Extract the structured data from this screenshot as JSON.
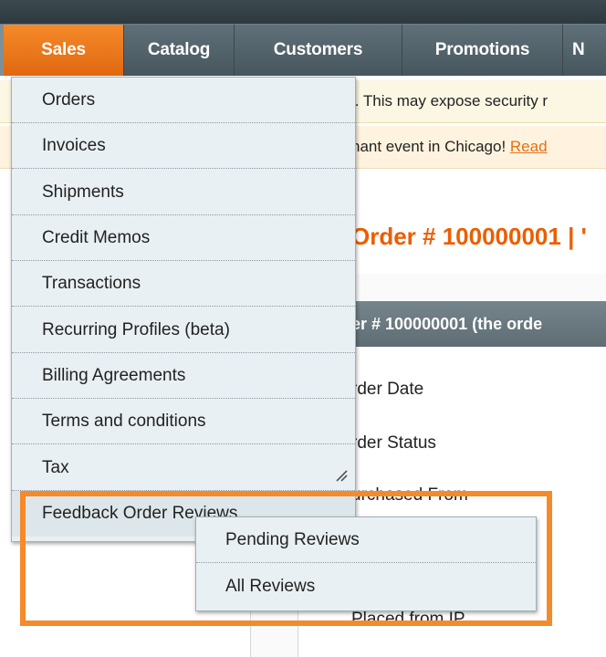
{
  "nav": {
    "tabs": [
      {
        "label": "Sales",
        "active": true
      },
      {
        "label": "Catalog"
      },
      {
        "label": "Customers"
      },
      {
        "label": "Promotions"
      },
      {
        "label": "N"
      }
    ]
  },
  "notices": {
    "security": "l. This may expose security r",
    "event_prefix": "hant event in Chicago! ",
    "event_link": "Read"
  },
  "page": {
    "title": "Order # 100000001 | '",
    "section_title": "er # 100000001 (the orde",
    "rows": [
      "rder Date",
      "rder Status",
      "urchased From",
      "Placed from IP"
    ]
  },
  "sales_menu": {
    "items": [
      "Orders",
      "Invoices",
      "Shipments",
      "Credit Memos",
      "Transactions",
      "Recurring Profiles (beta)",
      "Billing Agreements",
      "Terms and conditions",
      "Tax",
      "Feedback Order Reviews"
    ]
  },
  "feedback_submenu": {
    "items": [
      "Pending Reviews",
      "All Reviews"
    ]
  },
  "colors": {
    "accent": "#f58a2a",
    "nav_bg": "#5f7079",
    "title": "#eb5e00"
  }
}
